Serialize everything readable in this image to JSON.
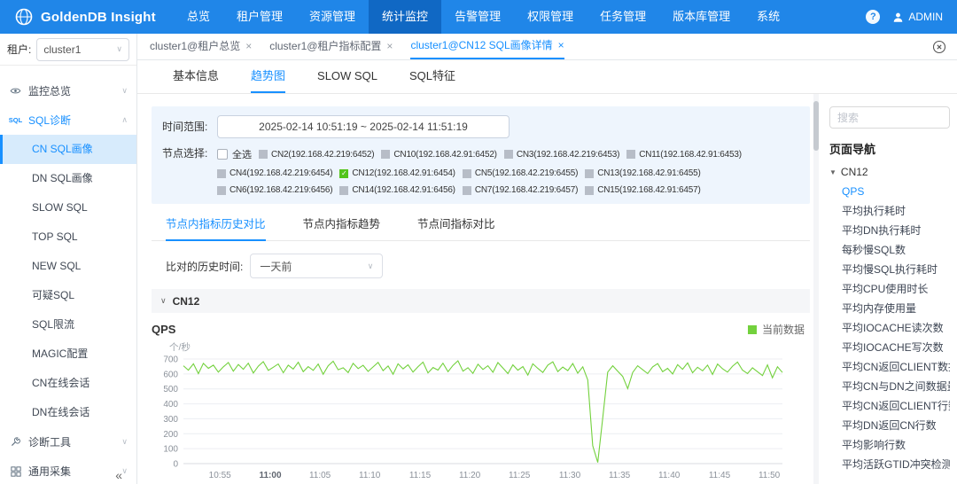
{
  "colors": {
    "accent": "#1890ff",
    "header_blue": "#2086e8",
    "active_nav_blue": "#1068c4",
    "line_green": "#73d13d",
    "checked_green": "#52c41a",
    "filter_bg": "#eef5fd"
  },
  "header": {
    "brand": "GoldenDB Insight",
    "user": "ADMIN",
    "help_glyph": "?",
    "nav": [
      {
        "label": "总览"
      },
      {
        "label": "租户管理"
      },
      {
        "label": "资源管理"
      },
      {
        "label": "统计监控",
        "active": true
      },
      {
        "label": "告警管理"
      },
      {
        "label": "权限管理"
      },
      {
        "label": "任务管理"
      },
      {
        "label": "版本库管理"
      },
      {
        "label": "系统"
      }
    ]
  },
  "tenant": {
    "label": "租户:",
    "value": "cluster1",
    "caret": "∨"
  },
  "sidebar": {
    "collapse_glyph": "«",
    "groups": [
      {
        "label": "监控总览",
        "icon": "eye-icon",
        "chevron": "∨"
      },
      {
        "label": "SQL诊断",
        "icon": "sql-icon",
        "icon_glyph": "SQL",
        "chevron": "∧",
        "active": true,
        "items": [
          {
            "label": "CN SQL画像",
            "active": true
          },
          {
            "label": "DN SQL画像"
          },
          {
            "label": "SLOW SQL"
          },
          {
            "label": "TOP SQL"
          },
          {
            "label": "NEW SQL"
          },
          {
            "label": "可疑SQL"
          },
          {
            "label": "SQL限流"
          },
          {
            "label": "MAGIC配置"
          },
          {
            "label": "CN在线会话"
          },
          {
            "label": "DN在线会话"
          }
        ]
      },
      {
        "label": "诊断工具",
        "icon": "tools-icon",
        "chevron": "∨"
      },
      {
        "label": "通用采集",
        "icon": "collect-icon",
        "chevron": "∨"
      }
    ]
  },
  "tabs": {
    "items": [
      {
        "label": "cluster1@租户总览",
        "close": "×"
      },
      {
        "label": "cluster1@租户指标配置",
        "close": "×"
      },
      {
        "label": "cluster1@CN12 SQL画像详情",
        "close": "×",
        "active": true
      }
    ]
  },
  "subtabs": [
    {
      "label": "基本信息"
    },
    {
      "label": "趋势图",
      "active": true
    },
    {
      "label": "SLOW SQL"
    },
    {
      "label": "SQL特征"
    }
  ],
  "filters": {
    "time_range_label": "时间范围:",
    "time_range_value": "2025-02-14 10:51:19  ~  2025-02-14 11:51:19",
    "node_label": "节点选择:",
    "select_all": "全选",
    "nodes": [
      {
        "label": "CN2(192.168.42.219:6452)",
        "check": ""
      },
      {
        "label": "CN10(192.168.42.91:6452)",
        "check": ""
      },
      {
        "label": "CN3(192.168.42.219:6453)",
        "check": ""
      },
      {
        "label": "CN11(192.168.42.91:6453)",
        "check": ""
      },
      {
        "label": "CN4(192.168.42.219:6454)",
        "check": ""
      },
      {
        "label": "CN12(192.168.42.91:6454)",
        "check": "✓",
        "checked": true
      },
      {
        "label": "CN5(192.168.42.219:6455)",
        "check": ""
      },
      {
        "label": "CN13(192.168.42.91:6455)",
        "check": ""
      },
      {
        "label": "CN6(192.168.42.219:6456)",
        "check": ""
      },
      {
        "label": "CN14(192.168.42.91:6456)",
        "check": ""
      },
      {
        "label": "CN7(192.168.42.219:6457)",
        "check": ""
      },
      {
        "label": "CN15(192.168.42.91:6457)",
        "check": ""
      }
    ]
  },
  "compare_tabs": [
    {
      "label": "节点内指标历史对比",
      "active": true
    },
    {
      "label": "节点内指标趋势"
    },
    {
      "label": "节点间指标对比"
    }
  ],
  "history": {
    "label": "比对的历史时间:",
    "value": "一天前",
    "caret": "∨"
  },
  "section": {
    "caret": "∨",
    "title": "CN12"
  },
  "chart_data": {
    "type": "line",
    "title": "QPS",
    "ylabel": "个/秒",
    "legend": "当前数据",
    "color": "#73d13d",
    "ylim": [
      0,
      700
    ],
    "y_ticks": [
      0,
      100,
      200,
      300,
      400,
      500,
      600,
      700
    ],
    "x_range": [
      "10:51:19",
      "11:51:19"
    ],
    "x_ticks": [
      {
        "label": "10:55",
        "frac": 0.061
      },
      {
        "label": "11:00",
        "frac": 0.145,
        "bold": true
      },
      {
        "label": "11:05",
        "frac": 0.228
      },
      {
        "label": "11:10",
        "frac": 0.311
      },
      {
        "label": "11:15",
        "frac": 0.395
      },
      {
        "label": "11:20",
        "frac": 0.478
      },
      {
        "label": "11:25",
        "frac": 0.561
      },
      {
        "label": "11:30",
        "frac": 0.645
      },
      {
        "label": "11:35",
        "frac": 0.728
      },
      {
        "label": "11:40",
        "frac": 0.811
      },
      {
        "label": "11:45",
        "frac": 0.895
      },
      {
        "label": "11:50",
        "frac": 0.978
      }
    ],
    "values": [
      655,
      625,
      668,
      602,
      671,
      638,
      659,
      612,
      648,
      676,
      618,
      663,
      631,
      672,
      606,
      652,
      682,
      624,
      645,
      667,
      608,
      659,
      633,
      678,
      615,
      649,
      624,
      666,
      598,
      655,
      685,
      628,
      641,
      609,
      671,
      636,
      658,
      617,
      647,
      677,
      622,
      653,
      598,
      668,
      634,
      661,
      612,
      649,
      679,
      607,
      643,
      626,
      672,
      615,
      657,
      688,
      619,
      642,
      604,
      665,
      630,
      655,
      611,
      676,
      640,
      603,
      661,
      625,
      649,
      592,
      668,
      637,
      610,
      659,
      681,
      616,
      646,
      622,
      670,
      605,
      648,
      560,
      120,
      8,
      305,
      612,
      655,
      618,
      584,
      502,
      610,
      655,
      628,
      603,
      647,
      669,
      615,
      638,
      600,
      662,
      631,
      674,
      608,
      645,
      621,
      659,
      597,
      666,
      635,
      612,
      652,
      680,
      626,
      603,
      641,
      615,
      589,
      660,
      574,
      648,
      610
    ]
  },
  "page_nav": {
    "search_placeholder": "搜索",
    "title": "页面导航",
    "expander": "▼",
    "group": "CN12",
    "items": [
      {
        "label": "QPS",
        "active": true
      },
      {
        "label": "平均执行耗时"
      },
      {
        "label": "平均DN执行耗时"
      },
      {
        "label": "每秒慢SQL数"
      },
      {
        "label": "平均慢SQL执行耗时"
      },
      {
        "label": "平均CPU使用时长"
      },
      {
        "label": "平均内存使用量"
      },
      {
        "label": "平均IOCACHE读次数"
      },
      {
        "label": "平均IOCACHE写次数"
      },
      {
        "label": "平均CN返回CLIENT数据..."
      },
      {
        "label": "平均CN与DN之间数据量"
      },
      {
        "label": "平均CN返回CLIENT行数"
      },
      {
        "label": "平均DN返回CN行数"
      },
      {
        "label": "平均影响行数"
      },
      {
        "label": "平均活跃GTID冲突检测..."
      }
    ]
  }
}
